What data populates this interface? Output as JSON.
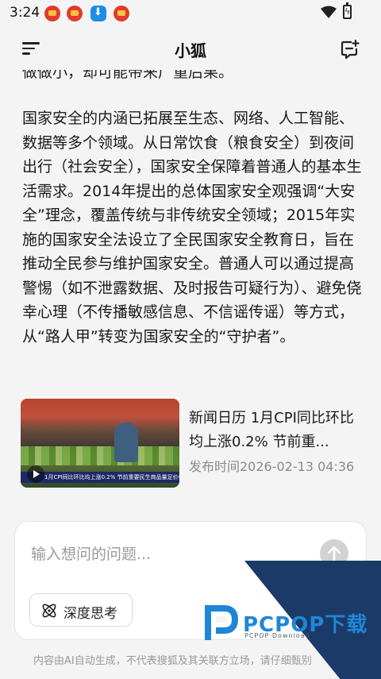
{
  "status_bar": {
    "time": "3:24",
    "icons": [
      "app-notification-icon",
      "app-notification-icon",
      "download-icon",
      "app-notification-icon",
      "wifi-icon",
      "battery-charging-icon"
    ]
  },
  "header": {
    "title": "小狐",
    "menu_icon": "menu-icon",
    "new_chat_icon": "new-chat-icon"
  },
  "article": {
    "cut_line": "做做小，却可能带来广重后果。",
    "paragraph": "国家安全的内涵已拓展至生态、网络、人工智能、数据等多个领域。从日常饮食（粮食安全）到夜间出行（社会安全），国家安全保障着普通人的基本生活需求。2014年提出的总体国家安全观强调“大安全”理念，覆盖传统与非传统安全领域；2015年实施的国家安全法设立了全民国家安全教育日，旨在推动全民参与维护国家安全。普通人可以通过提高警惕（如不泄露数据、及时报告可疑行为）、避免侥幸心理（不传播敏感信息、不信谣传谣）等方式，从“路人甲”转变为国家安全的“守护者”。"
  },
  "news_card": {
    "title": "新闻日历 1月CPI同比环比均上涨0.2% 节前重...",
    "time": "发布时间2026-02-13 04:36",
    "thumb_caption": "1月CPI同比环比均上涨0.2% 节前重要民生商品量足价稳"
  },
  "input": {
    "placeholder": "输入想问的问题...",
    "value": "",
    "deep_think_label": "深度思考"
  },
  "disclaimer": "内容由AI自动生成，不代表搜狐及其关联方立场，请仔细甄别",
  "watermark": {
    "text": "PCPOP下载",
    "sub": "PCPOP Download"
  },
  "colors": {
    "background": "#f4f4f4",
    "watermark_blue": "#1e86d6",
    "watermark_navy": "#1b3a68",
    "send_button": "#d2d2d2"
  }
}
